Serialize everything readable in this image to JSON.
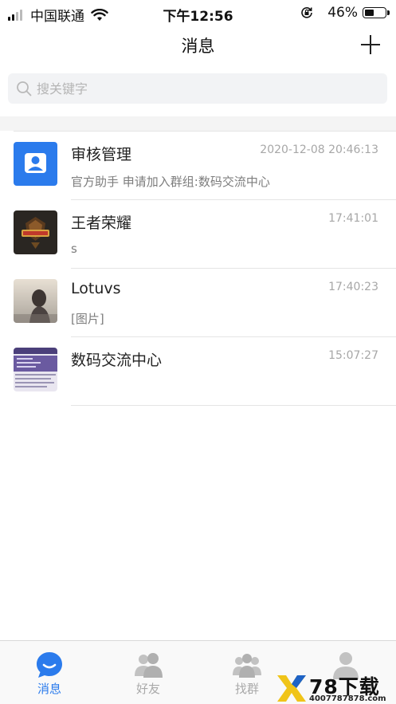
{
  "status_bar": {
    "carrier": "中国联通",
    "time": "下午12:56",
    "battery_percent": "46%",
    "battery_level": 0.46
  },
  "nav": {
    "title": "消息",
    "add_icon": "plus-icon"
  },
  "search": {
    "placeholder": "搜关键字",
    "value": "",
    "icon": "search-icon"
  },
  "conversations": [
    {
      "name": "审核管理",
      "time": "2020-12-08 20:46:13",
      "preview": "官方助手 申请加入群组:数码交流中心",
      "avatar": "user-icon"
    },
    {
      "name": "王者荣耀",
      "time": "17:41:01",
      "preview": "s",
      "avatar": "game-logo"
    },
    {
      "name": "Lotuvs",
      "time": "17:40:23",
      "preview": "[图片]",
      "avatar": "photo"
    },
    {
      "name": "数码交流中心",
      "time": "15:07:27",
      "preview": "",
      "avatar": "group-image"
    }
  ],
  "tabs": [
    {
      "label": "消息",
      "icon": "chat-bubble-icon",
      "active": true
    },
    {
      "label": "好友",
      "icon": "friends-icon",
      "active": false
    },
    {
      "label": "找群",
      "icon": "group-icon",
      "active": false
    },
    {
      "label": "",
      "icon": "profile-icon",
      "active": false
    }
  ],
  "watermark": {
    "brand": "78下载",
    "phone": "4007787878.com"
  },
  "colors": {
    "accent": "#2b7bec",
    "tab_inactive": "#a9a9a9",
    "divider": "#e5e5e5"
  }
}
